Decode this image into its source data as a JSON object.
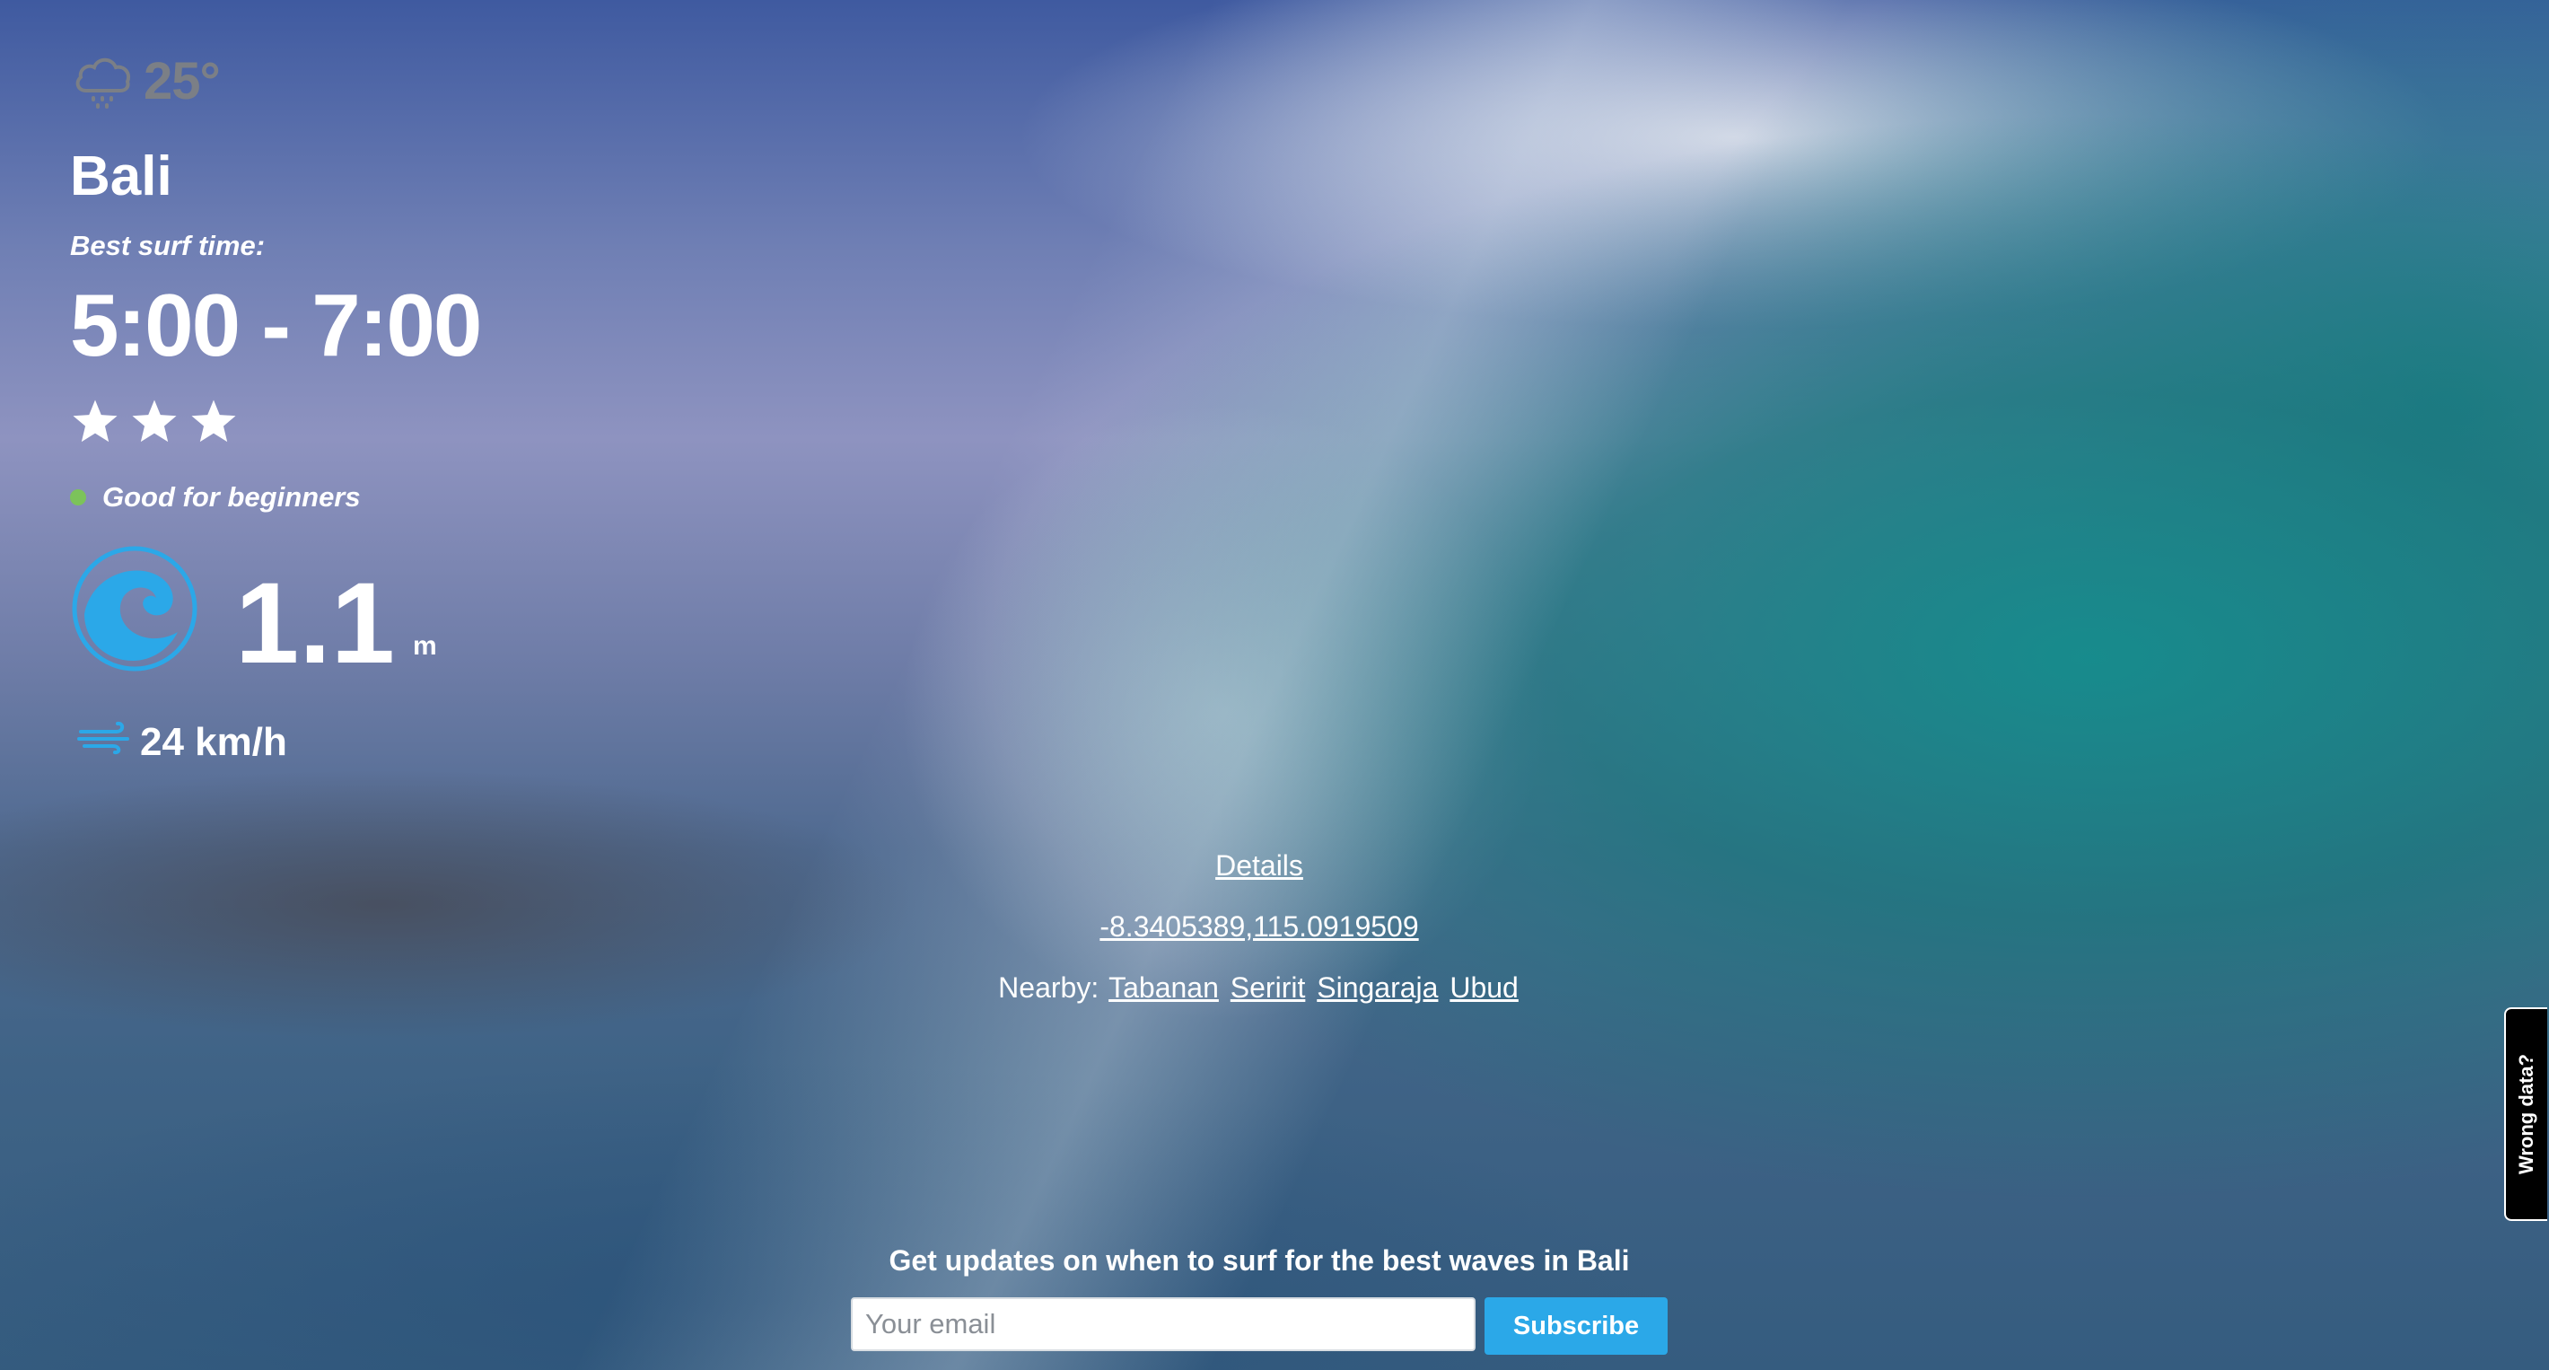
{
  "weather": {
    "icon": "rain-cloud-icon",
    "temperature": "25°"
  },
  "location": {
    "city": "Bali"
  },
  "surf": {
    "best_time_label": "Best surf time:",
    "best_time": "5:00 - 7:00",
    "rating_stars": 3,
    "level_label": "Good for beginners",
    "level_color": "#7cc35a",
    "wave_icon": "wave-icon",
    "wave_height": "1.1",
    "wave_unit": "m",
    "wind_icon": "wind-icon",
    "wind_speed": "24 km/h"
  },
  "links": {
    "details": "Details",
    "coordinates": "-8.3405389,115.0919509",
    "nearby_label": "Nearby:",
    "nearby": [
      "Tabanan",
      "Seririt",
      "Singaraja",
      "Ubud"
    ]
  },
  "subscribe": {
    "headline": "Get updates on when to surf for the best waves in Bali",
    "email_placeholder": "Your email",
    "button_label": "Subscribe",
    "button_color": "#2ba8e8"
  },
  "feedback": {
    "label": "Wrong data?"
  }
}
